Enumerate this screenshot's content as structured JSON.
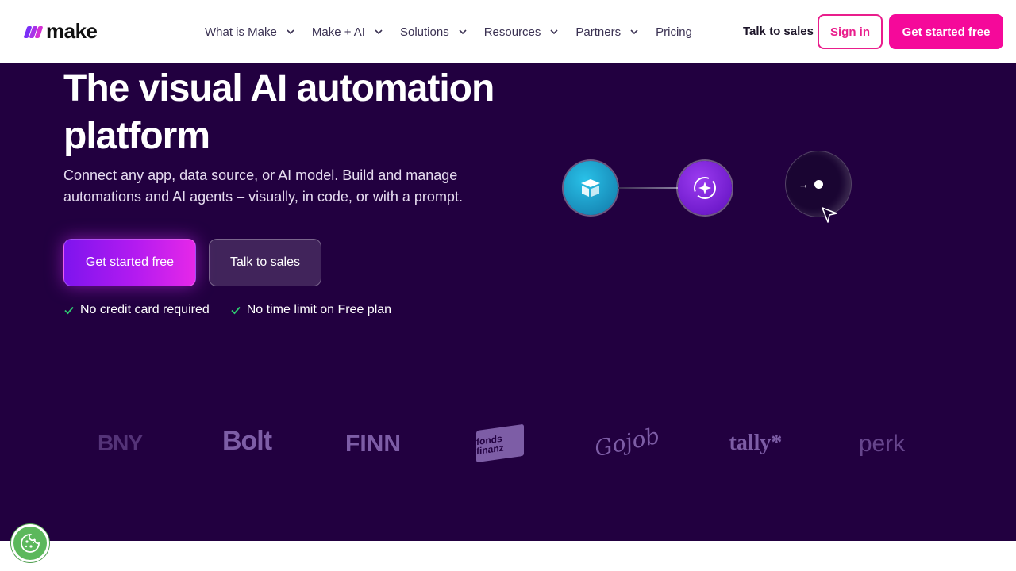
{
  "header": {
    "logo_text": "make",
    "nav": [
      {
        "label": "What is Make",
        "has_dropdown": true
      },
      {
        "label": "Make + AI",
        "has_dropdown": true
      },
      {
        "label": "Solutions",
        "has_dropdown": true
      },
      {
        "label": "Resources",
        "has_dropdown": true
      },
      {
        "label": "Partners",
        "has_dropdown": true
      },
      {
        "label": "Pricing",
        "has_dropdown": false
      }
    ],
    "talk_to_sales": "Talk to sales",
    "sign_in": "Sign in",
    "get_started": "Get started free"
  },
  "hero": {
    "headline_line1": "The visual AI automation",
    "headline_line2": "platform",
    "subtext": "Connect any app, data source, or AI model. Build and manage automations and AI agents – visually, in code, or with a prompt.",
    "primary_cta": "Get started free",
    "secondary_cta": "Talk to sales",
    "checks": [
      "No credit card required",
      "No time limit on Free plan"
    ]
  },
  "diagram": {
    "nodes": [
      {
        "icon": "airtable-icon",
        "color": "#1fa9d6"
      },
      {
        "icon": "ai-sparkle-icon",
        "color": "#8126e0"
      },
      {
        "icon": "next-step-icon",
        "color": "#1a0532"
      }
    ]
  },
  "logos": [
    "BNY",
    "Bolt",
    "FINN",
    "fonds finanz",
    "Gojob",
    "tally*",
    "perk"
  ],
  "colors": {
    "brand_pink": "#f5099a",
    "hero_bg": "#220040",
    "logo_color": "#7d5da6",
    "cookie_green": "#5cb85c"
  },
  "cookie": {
    "icon": "cookie-icon"
  }
}
